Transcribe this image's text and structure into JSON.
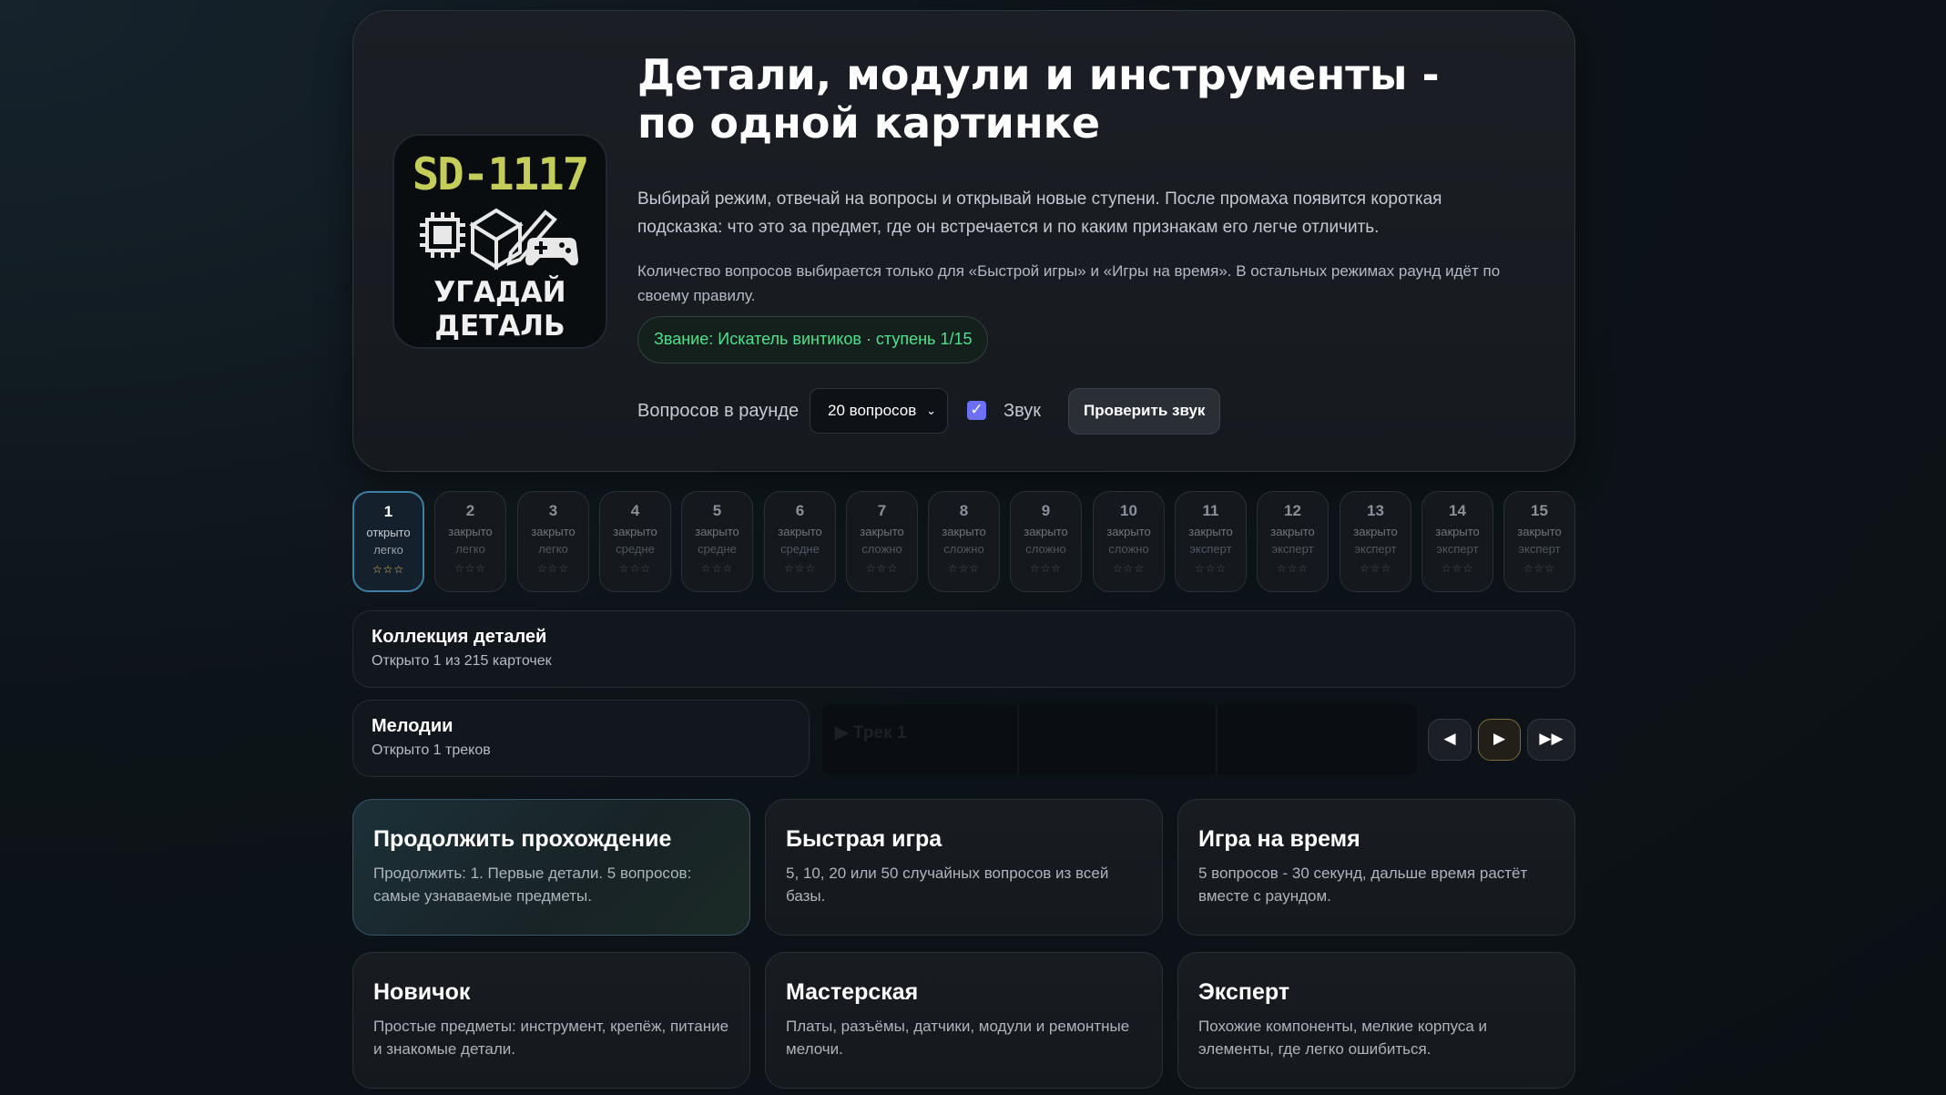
{
  "header": {
    "logo": {
      "code": "SD-1117",
      "caption_line1": "УГАДАЙ",
      "caption_line2": "ДЕТАЛЬ",
      "icons": [
        "chip-icon",
        "cube-icon",
        "pencil-icon",
        "gamepad-icon"
      ]
    },
    "title": "Детали, модули и инструменты - по одной картинке",
    "description": "Выбирай режим, отвечай на вопросы и открывай новые ступени. После промаха появится короткая подсказка: что это за предмет, где он встречается и по каким признакам его легче отличить.",
    "note": "Количество вопросов выбирается только для «Быстрой игры» и «Игры на время». В остальных режимах раунд идёт по своему правилу.",
    "rank": "Звание: Искатель винтиков · ступень 1/15",
    "controls": {
      "questions_label": "Вопросов в раунде",
      "questions_value": "20 вопросов",
      "sound_label": "Звук",
      "sound_checked": true,
      "check_sound_label": "Проверить звук"
    }
  },
  "stages": [
    {
      "num": "1",
      "state": "открыто",
      "level": "легко",
      "stars": "☆☆☆",
      "open": true
    },
    {
      "num": "2",
      "state": "закрыто",
      "level": "легко",
      "stars": "☆☆☆",
      "open": false
    },
    {
      "num": "3",
      "state": "закрыто",
      "level": "легко",
      "stars": "☆☆☆",
      "open": false
    },
    {
      "num": "4",
      "state": "закрыто",
      "level": "средне",
      "stars": "☆☆☆",
      "open": false
    },
    {
      "num": "5",
      "state": "закрыто",
      "level": "средне",
      "stars": "☆☆☆",
      "open": false
    },
    {
      "num": "6",
      "state": "закрыто",
      "level": "средне",
      "stars": "☆☆☆",
      "open": false
    },
    {
      "num": "7",
      "state": "закрыто",
      "level": "сложно",
      "stars": "☆☆☆",
      "open": false
    },
    {
      "num": "8",
      "state": "закрыто",
      "level": "сложно",
      "stars": "☆☆☆",
      "open": false
    },
    {
      "num": "9",
      "state": "закрыто",
      "level": "сложно",
      "stars": "☆☆☆",
      "open": false
    },
    {
      "num": "10",
      "state": "закрыто",
      "level": "сложно",
      "stars": "☆☆☆",
      "open": false
    },
    {
      "num": "11",
      "state": "закрыто",
      "level": "эксперт",
      "stars": "☆☆☆",
      "open": false
    },
    {
      "num": "12",
      "state": "закрыто",
      "level": "эксперт",
      "stars": "☆☆☆",
      "open": false
    },
    {
      "num": "13",
      "state": "закрыто",
      "level": "эксперт",
      "stars": "☆☆☆",
      "open": false
    },
    {
      "num": "14",
      "state": "закрыто",
      "level": "эксперт",
      "stars": "☆☆☆",
      "open": false
    },
    {
      "num": "15",
      "state": "закрыто",
      "level": "эксперт",
      "stars": "☆☆☆",
      "open": false
    }
  ],
  "collection": {
    "title": "Коллекция деталей",
    "subtitle": "Открыто 1 из 215 карточек"
  },
  "melodies": {
    "title": "Мелодии",
    "subtitle": "Открыто 1 треков",
    "track_label": "▶ Трек 1",
    "player": {
      "prev_icon": "◀",
      "play_icon": "▶",
      "next_icon": "▶▶"
    }
  },
  "modes": [
    {
      "title": "Продолжить прохождение",
      "desc": "Продолжить: 1. Первые детали. 5 вопросов: самые узнаваемые предметы.",
      "active": true
    },
    {
      "title": "Быстрая игра",
      "desc": "5, 10, 20 или 50 случайных вопросов из всей базы.",
      "active": false
    },
    {
      "title": "Игра на время",
      "desc": "5 вопросов - 30 секунд, дальше время растёт вместе с раундом.",
      "active": false
    },
    {
      "title": "Новичок",
      "desc": "Простые предметы: инструмент, крепёж, питание и знакомые детали.",
      "active": false
    },
    {
      "title": "Мастерская",
      "desc": "Платы, разъёмы, датчики, модули и ремонтные мелочи.",
      "active": false
    },
    {
      "title": "Эксперт",
      "desc": "Похожие компоненты, мелкие корпуса и элементы, где легко ошибиться.",
      "active": false
    }
  ],
  "colors": {
    "accent_green": "#4fe08f",
    "accent_blue": "#3d7fa6",
    "star_gold": "#e4c25c",
    "checkbox": "#6d6ff5"
  }
}
